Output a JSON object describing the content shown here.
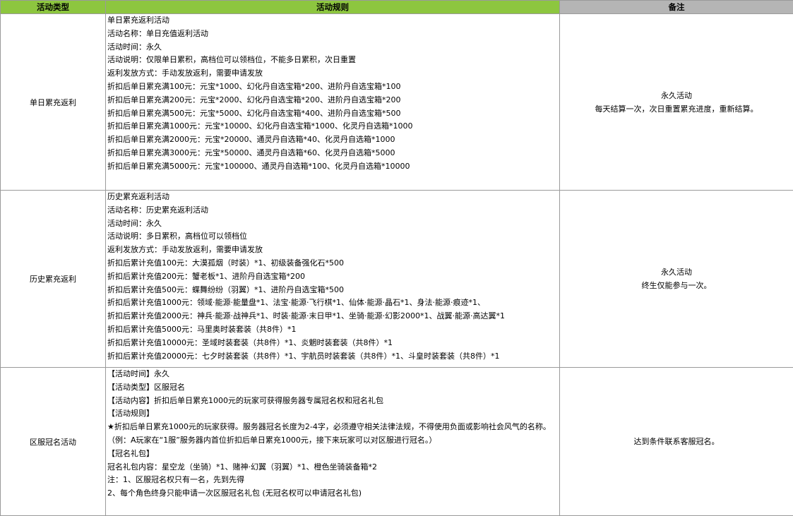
{
  "headers": {
    "type": "活动类型",
    "rules": "活动规则",
    "notes": "备注"
  },
  "rows": [
    {
      "type": "单日累充返利",
      "rules": [
        "单日累充返利活动",
        "活动名称：单日充值返利活动",
        "活动时间：永久",
        "活动说明：仅限单日累积，高档位可以领档位，不能多日累积，次日重置",
        "返利发放方式：手动发放返利，需要申请发放",
        "折扣后单日累充满100元：元宝*1000、幻化丹自选宝箱*200、进阶丹自选宝箱*100",
        "折扣后单日累充满200元：元宝*2000、幻化丹自选宝箱*200、进阶丹自选宝箱*200",
        "折扣后单日累充满500元：元宝*5000、幻化丹自选宝箱*400、进阶丹自选宝箱*500",
        "折扣后单日累充满1000元：元宝*10000、幻化丹自选宝箱*1000、化灵丹自选箱*1000",
        "折扣后单日累充满2000元：元宝*20000、通灵丹自选箱*40、化灵丹自选箱*1000",
        "折扣后单日累充满3000元：元宝*50000、通灵丹自选箱*60、化灵丹自选箱*5000",
        "折扣后单日累充满5000元：元宝*100000、通灵丹自选箱*100、化灵丹自选箱*10000"
      ],
      "notes": [
        "永久活动",
        "每天结算一次，次日重置累充进度，重新结算。"
      ]
    },
    {
      "type": "历史累充返利",
      "rules": [
        "历史累充返利活动",
        "活动名称：历史累充返利活动",
        "活动时间：永久",
        "活动说明：多日累积，高档位可以领档位",
        "返利发放方式：手动发放返利，需要申请发放",
        "折扣后累计充值100元：大漠孤烟（时装）*1、初级装备强化石*500",
        "折扣后累计充值200元：蟹老板*1、进阶丹自选宝箱*200",
        "折扣后累计充值500元：蝶舞纷纷（羽翼）*1、进阶丹自选宝箱*500",
        "折扣后累计充值1000元：领域·能源·能量盘*1、法宝·能源·飞行棋*1、仙体·能源·晶石*1、身法·能源·痕迹*1、",
        "折扣后累计充值2000元：神兵·能源·战神兵*1、时装·能源·末日甲*1、坐骑·能源·幻影2000*1、战翼·能源·高达翼*1",
        "折扣后累计充值5000元：马里奥时装套装（共8件）*1",
        "折扣后累计充值10000元：圣域时装套装（共8件）*1、炎魍时装套装（共8件）*1",
        "折扣后累计充值20000元：七夕时装套装（共8件）*1、宇航员时装套装（共8件）*1、斗皇时装套装（共8件）*1"
      ],
      "notes": [
        "永久活动",
        "终生仅能参与一次。"
      ]
    },
    {
      "type": "区服冠名活动",
      "rules": [
        "【活动时间】永久",
        "【活动类型】区服冠名",
        "【活动内容】折扣后单日累充1000元的玩家可获得服务器专属冠名权和冠名礼包",
        "【活动规则】",
        "★折扣后单日累充1000元的玩家获得。服务器冠名长度为2-4字，必须遵守相关法律法规，不得使用负面或影响社会风气的名称。",
        "（例：A玩家在“1服”服务器内首位折扣后单日累充1000元，接下来玩家可以对区服进行冠名。）",
        "【冠名礼包】",
        "冠名礼包内容：星空龙（坐骑）*1、赌神·幻翼（羽翼）*1、橙色坐骑装备箱*2",
        "注：1、区服冠名权只有一名，先到先得",
        "2、每个角色终身只能申请一次区服冠名礼包 (无冠名权可以申请冠名礼包)"
      ],
      "notes": [
        "达到条件联系客服冠名。"
      ]
    }
  ]
}
